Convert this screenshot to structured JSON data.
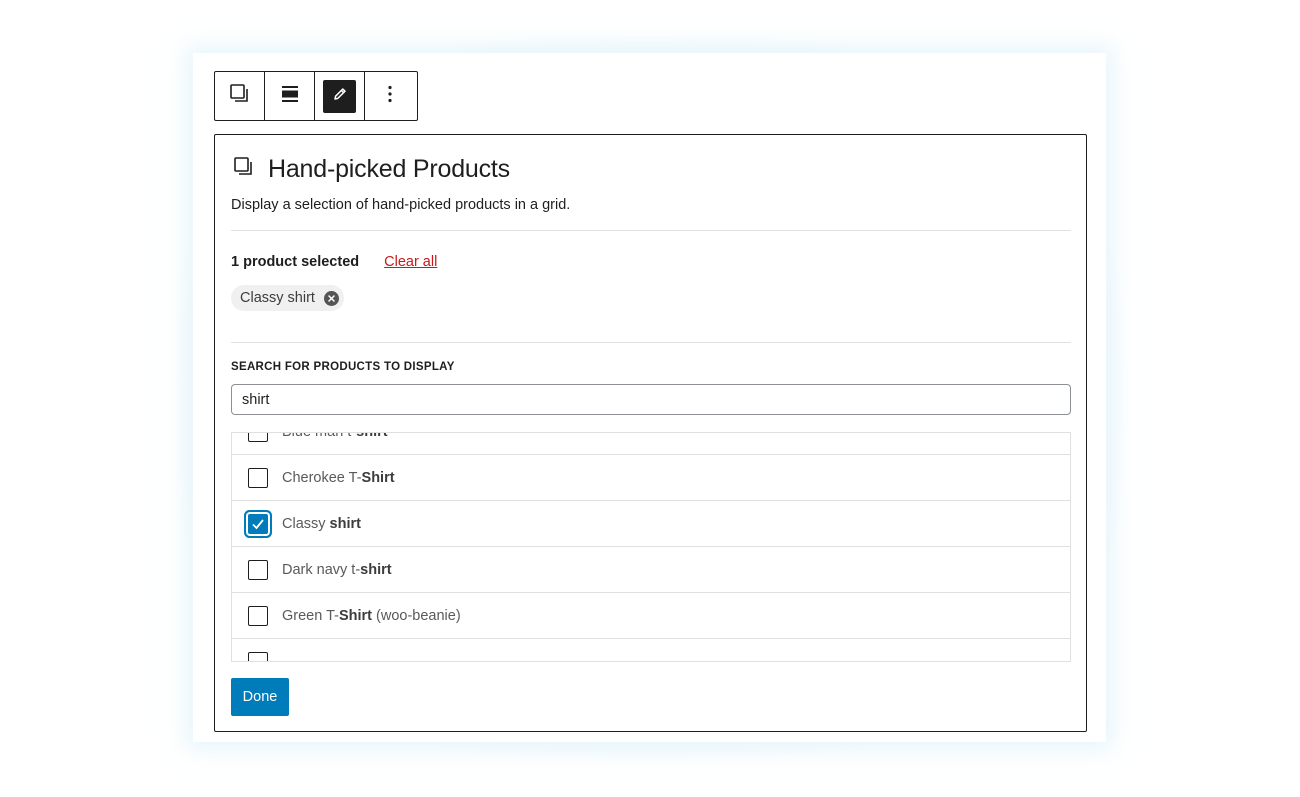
{
  "toolbar": {
    "buttons": [
      {
        "name": "block-type",
        "icon": "stacked-squares-icon"
      },
      {
        "name": "align",
        "icon": "align-center-icon"
      },
      {
        "name": "edit",
        "icon": "pencil-icon",
        "active": true
      },
      {
        "name": "more-options",
        "icon": "vertical-ellipsis-icon"
      }
    ]
  },
  "block": {
    "icon": "stacked-squares-icon",
    "title": "Hand-picked Products",
    "description": "Display a selection of hand-picked products in a grid.",
    "selected_count_label": "1 product selected",
    "clear_all_label": "Clear all",
    "selected_items": [
      "Classy shirt"
    ],
    "search": {
      "label": "SEARCH FOR PRODUCTS TO DISPLAY",
      "value": "shirt"
    },
    "results": [
      {
        "prefix": "Blue man t-",
        "match": "shirt",
        "suffix": "",
        "checked": false
      },
      {
        "prefix": "Cherokee T-",
        "match": "Shirt",
        "suffix": "",
        "checked": false
      },
      {
        "prefix": "Classy ",
        "match": "shirt",
        "suffix": "",
        "checked": true
      },
      {
        "prefix": "Dark navy t-",
        "match": "shirt",
        "suffix": "",
        "checked": false
      },
      {
        "prefix": "Green T-",
        "match": "Shirt",
        "suffix": " (woo-beanie)",
        "checked": false
      },
      {
        "prefix": "",
        "match": "",
        "suffix": "",
        "checked": false
      }
    ],
    "done_label": "Done"
  },
  "colors": {
    "accent": "#007cba",
    "clear_all": "#cc1818",
    "text": "#1e1e1e",
    "border": "#1e1e1e",
    "chip_bg": "#f0f0f0"
  }
}
